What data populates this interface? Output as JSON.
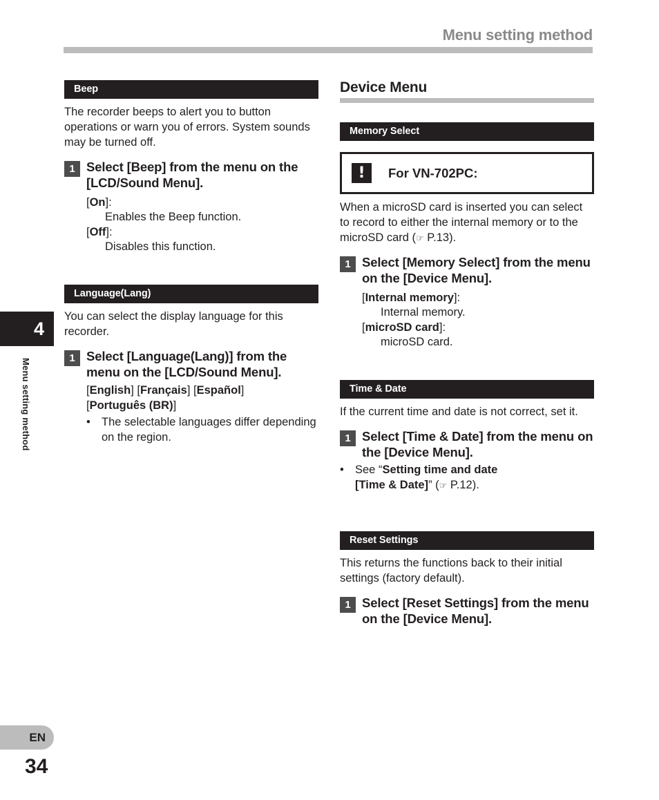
{
  "page": {
    "header_title": "Menu setting method",
    "chapter_number": "4",
    "chapter_label": "Menu setting method",
    "language_code": "EN",
    "page_number": "34"
  },
  "left_column": {
    "beep": {
      "bar_label": "Beep",
      "intro": "The recorder beeps to alert you to button operations or warn you of errors. System sounds may be turned off.",
      "step": {
        "number": "1",
        "text_html": "Select [<b>Beep</b>] from the menu on the [<b>LCD/Sound Menu</b>]."
      },
      "options": [
        {
          "term_html": "[<b>On</b>]:",
          "desc": "Enables the Beep function."
        },
        {
          "term_html": "[<b>Off</b>]:",
          "desc": "Disables this function."
        }
      ]
    },
    "language": {
      "bar_label": "Language(Lang)",
      "intro": "You can select the display language for this recorder.",
      "step": {
        "number": "1",
        "text_html": "Select [<b>Language(Lang)</b>] from the menu on the [<b>LCD/Sound Menu</b>]."
      },
      "language_list_html": "[<b>English</b>] [<b>Français</b>] [<b>Español</b>]<br>[<b>Português (BR)</b>]",
      "note": {
        "bullet": "•",
        "text_html": "The selectable languages differ depending on the region."
      }
    }
  },
  "right_column": {
    "section_title": "Device Menu",
    "memory_select": {
      "bar_label": "Memory Select",
      "callout": {
        "icon": "exclamation-icon",
        "icon_glyph": "!",
        "text": "For VN-702PC:"
      },
      "intro_html": "When a microSD card is inserted you can select to record to either the internal memory or to the microSD card (<span class=\"hand\">☞</span> P.13).",
      "step": {
        "number": "1",
        "text_html": "Select [<b>Memory Select</b>] from the menu on the [<b>Device Menu</b>]."
      },
      "options": [
        {
          "term_html": "[<b>Internal memory</b>]:",
          "desc": "Internal memory."
        },
        {
          "term_html": "[<b>microSD card</b>]:",
          "desc": "microSD card."
        }
      ]
    },
    "time_date": {
      "bar_label": "Time & Date",
      "intro": "If the current time and date is not correct, set it.",
      "step": {
        "number": "1",
        "text_html": "Select [<b>Time &amp; Date</b>] from the menu on the [<b>Device Menu</b>]."
      },
      "note": {
        "bullet": "•",
        "text_html": "See “<b>Setting time and date<br>[Time &amp; Date]</b>” (<span class=\"hand\">☞</span> P.12)."
      }
    },
    "reset_settings": {
      "bar_label": "Reset Settings",
      "intro": "This returns the functions back to their initial settings (factory default).",
      "step": {
        "number": "1",
        "text_html": "Select [<b>Reset Settings</b>] from the menu on the [<b>Device Menu</b>]."
      }
    }
  },
  "colors": {
    "bar_black": "#231f20",
    "rule_gray": "#bcbcbc",
    "header_gray": "#8a8a8a",
    "badge_gray": "#4d4d4d"
  }
}
